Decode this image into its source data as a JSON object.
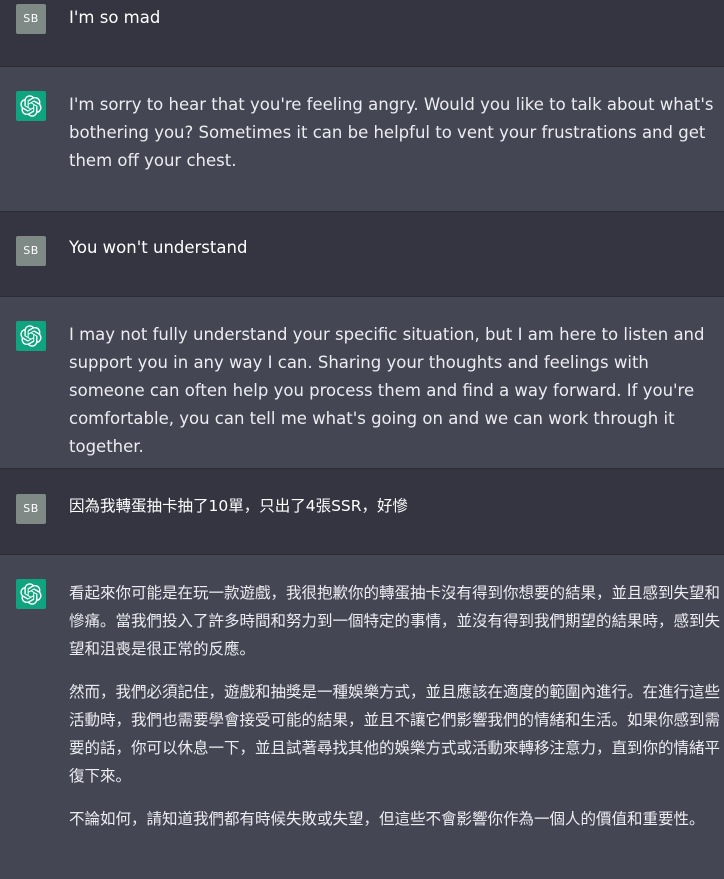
{
  "user": {
    "avatar_initials": "SB"
  },
  "assistant": {
    "avatar_icon": "openai-logo-icon"
  },
  "messages": [
    {
      "role": "user",
      "paragraphs": [
        "I'm so mad"
      ]
    },
    {
      "role": "assistant",
      "paragraphs": [
        "I'm sorry to hear that you're feeling angry. Would you like to talk about what's bothering you? Sometimes it can be helpful to vent your frustrations and get them off your chest."
      ]
    },
    {
      "role": "user",
      "paragraphs": [
        "You won't understand"
      ]
    },
    {
      "role": "assistant",
      "paragraphs": [
        "I may not fully understand your specific situation, but I am here to listen and support you in any way I can. Sharing your thoughts and feelings with someone can often help you process them and find a way forward. If you're comfortable, you can tell me what's going on and we can work through it together."
      ]
    },
    {
      "role": "user",
      "paragraphs": [
        "因為我轉蛋抽卡抽了10單，只出了4張SSR，好慘"
      ]
    },
    {
      "role": "assistant",
      "paragraphs": [
        "看起來你可能是在玩一款遊戲，我很抱歉你的轉蛋抽卡沒有得到你想要的結果，並且感到失望和慘痛。當我們投入了許多時間和努力到一個特定的事情，並沒有得到我們期望的結果時，感到失望和沮喪是很正常的反應。",
        "然而，我們必須記住，遊戲和抽獎是一種娛樂方式，並且應該在適度的範圍內進行。在進行這些活動時，我們也需要學會接受可能的結果，並且不讓它們影響我們的情緒和生活。如果你感到需要的話，你可以休息一下，並且試著尋找其他的娛樂方式或活動來轉移注意力，直到你的情緒平復下來。",
        "不論如何，請知道我們都有時候失敗或失望，但這些不會影響你作為一個人的價值和重要性。"
      ]
    }
  ]
}
